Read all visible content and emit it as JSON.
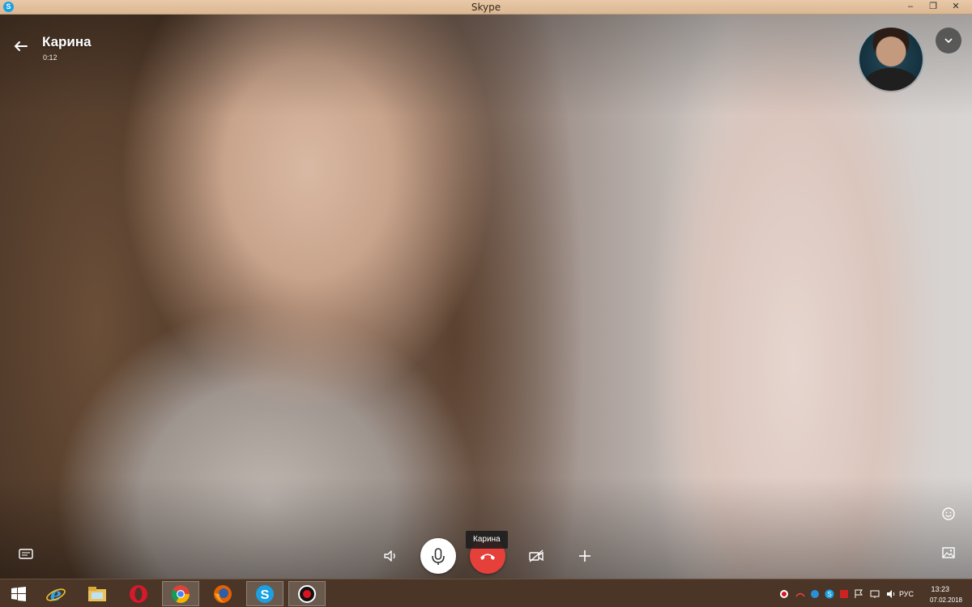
{
  "window": {
    "title": "Skype",
    "app_icon": "S",
    "controls": {
      "minimize": "–",
      "restore": "❐",
      "close": "✕"
    }
  },
  "call": {
    "contact_name": "Карина",
    "duration": "0:12",
    "tooltip": "Карина",
    "icons": {
      "back": "arrow-left-icon",
      "collapse": "chevron-down-icon",
      "chat": "chat-icon",
      "speaker": "speaker-icon",
      "mic": "microphone-icon",
      "hangup": "hang-up-icon",
      "video": "video-off-icon",
      "add": "plus-icon",
      "emoji": "emoji-icon",
      "screenshot": "image-icon"
    },
    "colors": {
      "hangup": "#e5413a",
      "mic_bg": "#ffffff"
    }
  },
  "taskbar": {
    "apps": [
      {
        "name": "start",
        "icon": "windows-icon"
      },
      {
        "name": "internet-explorer",
        "icon": "ie-icon"
      },
      {
        "name": "file-explorer",
        "icon": "folder-icon"
      },
      {
        "name": "opera",
        "icon": "opera-icon"
      },
      {
        "name": "chrome",
        "icon": "chrome-icon"
      },
      {
        "name": "firefox",
        "icon": "firefox-icon"
      },
      {
        "name": "skype",
        "icon": "skype-icon"
      },
      {
        "name": "recorder",
        "icon": "record-icon"
      }
    ],
    "language": "РУС",
    "time": "13:23",
    "date": "07.02.2018"
  }
}
